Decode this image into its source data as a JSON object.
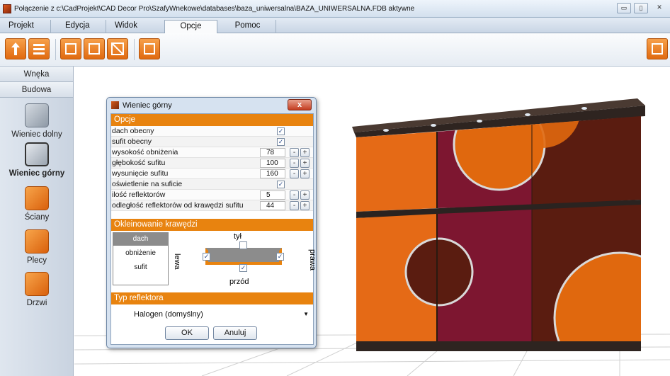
{
  "window": {
    "title": "Połączenie z c:\\CadProjekt\\CAD Decor Pro\\SzafyWnekowe\\databases\\baza_uniwersalna\\BAZA_UNIWERSALNA.FDB aktywne",
    "buttons": [
      "▭",
      "▯",
      "✕"
    ]
  },
  "menu": {
    "tabs": [
      "Projekt",
      "Edycja",
      "Widok",
      "Opcje",
      "Pomoc"
    ],
    "active": "Opcje"
  },
  "toolbar": {
    "icons": [
      "arrow-up-icon",
      "list-icon",
      "chart-icon",
      "stack-icon",
      "diagonal-icon",
      "grid-icon",
      "calculator-icon"
    ]
  },
  "sidebar": {
    "sections": [
      "Wnęka",
      "Budowa"
    ],
    "items": [
      {
        "label": "Wieniec dolny",
        "icon": "bottom-panel-icon"
      },
      {
        "label": "Wieniec górny",
        "icon": "top-panel-icon",
        "selected": true
      },
      {
        "label": "Ściany",
        "icon": "walls-icon"
      },
      {
        "label": "Plecy",
        "icon": "back-panel-icon"
      },
      {
        "label": "Drzwi",
        "icon": "doors-icon"
      }
    ]
  },
  "dialog": {
    "title": "Wieniec górny",
    "close_label": "x",
    "options_header": "Opcje",
    "options": [
      {
        "label": "dach obecny",
        "type": "check",
        "checked": true
      },
      {
        "label": "sufit obecny",
        "type": "check",
        "checked": true
      },
      {
        "label": "wysokość obniżenia",
        "type": "num",
        "value": "78"
      },
      {
        "label": "głębokość sufitu",
        "type": "num",
        "value": "100"
      },
      {
        "label": "wysunięcie sufitu",
        "type": "num",
        "value": "160"
      },
      {
        "label": "oświetlenie na suficie",
        "type": "check",
        "checked": true
      },
      {
        "label": "ilość reflektorów",
        "type": "num",
        "value": "5"
      },
      {
        "label": "odległość reflektorów od krawędzi sufitu",
        "type": "num",
        "value": "44"
      }
    ],
    "edge_header": "Okleinowanie krawędzi",
    "edge_list": [
      "dach",
      "obniżenie",
      "sufit"
    ],
    "edge_selected": "dach",
    "edge_labels": {
      "top": "tył",
      "bottom": "przód",
      "left": "lewa",
      "right": "prawa"
    },
    "reflector_header": "Typ reflektora",
    "reflector_value": "Halogen (domyślny)",
    "ok_label": "OK",
    "cancel_label": "Anuluj"
  },
  "colors": {
    "accent": "#e8830f",
    "door_orange": "#e06a18",
    "door_wine": "#7e1530",
    "door_brown": "#5a1e10"
  }
}
